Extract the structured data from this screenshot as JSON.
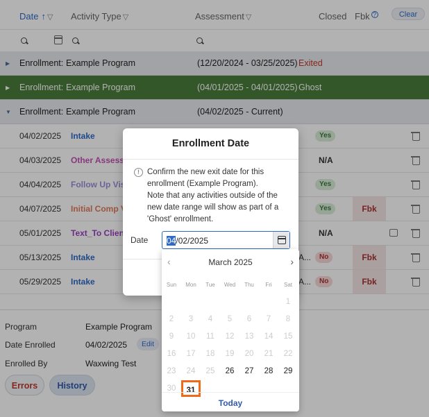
{
  "header": {
    "date": "Date",
    "activity_type": "Activity Type",
    "assessment": "Assessment",
    "closed": "Closed",
    "fbk": "Fbk",
    "clear": "Clear"
  },
  "enrollments": [
    {
      "label": "Enrollment:",
      "program": "Example Program",
      "range": "(12/20/2024 - 03/25/2025)",
      "status": "Exited"
    },
    {
      "label": "Enrollment:",
      "program": "Example Program",
      "range": "(04/01/2025 - 04/01/2025)",
      "status": "Ghost"
    },
    {
      "label": "Enrollment:",
      "program": "Example Program",
      "range": "(04/02/2025 - Current)",
      "status": ""
    }
  ],
  "activities": [
    {
      "date": "04/02/2025",
      "name": "Intake",
      "color": "#2f6ac6",
      "closed": "Yes",
      "fbk": ""
    },
    {
      "date": "04/03/2025",
      "name": "Other Assessm",
      "color": "#c44fb4",
      "closed": "N/A",
      "fbk": ""
    },
    {
      "date": "04/04/2025",
      "name": "Follow Up Visit",
      "color": "#9a8fd8",
      "closed": "Yes",
      "fbk": ""
    },
    {
      "date": "04/07/2025",
      "name": "Initial Comp Vi",
      "color": "#e07a5a",
      "closed": "Yes",
      "fbk": "Fbk"
    },
    {
      "date": "05/01/2025",
      "name": "Text_To Client",
      "color": "#9b3fbf",
      "closed": "N/A",
      "fbk": ""
    },
    {
      "date": "05/13/2025",
      "name": "Intake",
      "color": "#2f6ac6",
      "assess": "A...",
      "closed": "No",
      "fbk": "Fbk"
    },
    {
      "date": "05/29/2025",
      "name": "Intake",
      "color": "#2f6ac6",
      "assess": "A...",
      "closed": "No",
      "fbk": "Fbk"
    }
  ],
  "detail": {
    "program_label": "Program",
    "program_value": "Example Program",
    "date_enrolled_label": "Date Enrolled",
    "date_enrolled_value": "04/02/2025",
    "edit": "Edit",
    "enrolled_by_label": "Enrolled By",
    "enrolled_by_value": "Waxwing Test",
    "errors_tab": "Errors",
    "history_tab": "History"
  },
  "modal": {
    "title": "Enrollment Date",
    "message_line1": "Confirm the new exit date for this",
    "message_line2": "enrollment (Example Program).",
    "message_line3": "Note that any activities outside of the",
    "message_line4": "new date range will show as part of a",
    "message_line5": "'Ghost' enrollment.",
    "date_label": "Date",
    "date_selected_part": "04",
    "date_rest": "/02/2025"
  },
  "calendar": {
    "month": "March 2025",
    "weekdays": [
      "Sun",
      "Mon",
      "Tue",
      "Wed",
      "Thu",
      "Fri",
      "Sat"
    ],
    "today": "Today"
  }
}
